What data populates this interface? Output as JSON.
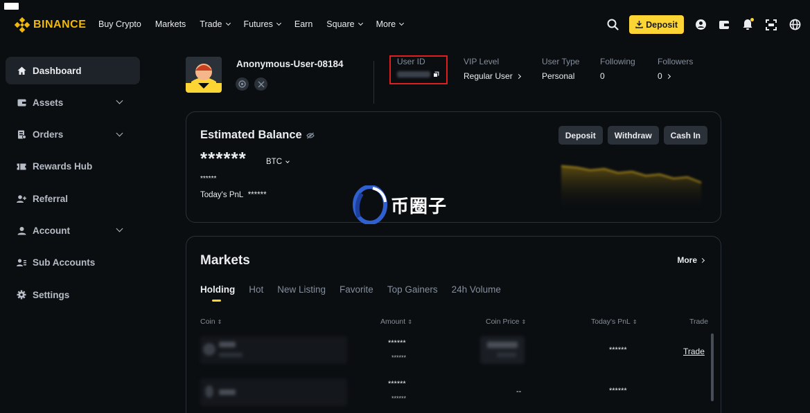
{
  "brand": {
    "name": "BINANCE",
    "color": "#f0b90b"
  },
  "header": {
    "nav": [
      {
        "label": "Buy Crypto",
        "dropdown": false
      },
      {
        "label": "Markets",
        "dropdown": false
      },
      {
        "label": "Trade",
        "dropdown": true
      },
      {
        "label": "Futures",
        "dropdown": true
      },
      {
        "label": "Earn",
        "dropdown": false
      },
      {
        "label": "Square",
        "dropdown": true
      },
      {
        "label": "More",
        "dropdown": true
      }
    ],
    "deposit_label": "Deposit",
    "icons": [
      "search-icon",
      "download-icon",
      "account-icon",
      "wallet-icon",
      "bell-icon",
      "qr-download-icon",
      "globe-icon"
    ]
  },
  "sidebar": {
    "items": [
      {
        "label": "Dashboard",
        "icon": "home-icon",
        "active": true,
        "expandable": false
      },
      {
        "label": "Assets",
        "icon": "wallet-icon",
        "active": false,
        "expandable": true
      },
      {
        "label": "Orders",
        "icon": "orders-icon",
        "active": false,
        "expandable": true
      },
      {
        "label": "Rewards Hub",
        "icon": "ticket-icon",
        "active": false,
        "expandable": false
      },
      {
        "label": "Referral",
        "icon": "add-user-icon",
        "active": false,
        "expandable": false
      },
      {
        "label": "Account",
        "icon": "user-icon",
        "active": false,
        "expandable": true
      },
      {
        "label": "Sub Accounts",
        "icon": "users-icon",
        "active": false,
        "expandable": false
      },
      {
        "label": "Settings",
        "icon": "gear-icon",
        "active": false,
        "expandable": false
      }
    ]
  },
  "profile": {
    "username": "Anonymous-User-08184",
    "user_id_label": "User ID",
    "vip_label": "VIP Level",
    "vip_value": "Regular User",
    "user_type_label": "User Type",
    "user_type_value": "Personal",
    "following_label": "Following",
    "following_value": "0",
    "followers_label": "Followers",
    "followers_value": "0"
  },
  "balance": {
    "title": "Estimated Balance",
    "value": "******",
    "unit": "BTC",
    "sub_value": "******",
    "pnl_label": "Today's PnL",
    "pnl_value": "******",
    "buttons": {
      "deposit": "Deposit",
      "withdraw": "Withdraw",
      "cash_in": "Cash In"
    }
  },
  "markets": {
    "title": "Markets",
    "more_label": "More",
    "tabs": [
      "Holding",
      "Hot",
      "New Listing",
      "Favorite",
      "Top Gainers",
      "24h Volume"
    ],
    "active_tab": "Holding",
    "columns": {
      "coin": "Coin",
      "amount": "Amount",
      "price": "Coin Price",
      "pnl": "Today's PnL",
      "trade": "Trade"
    },
    "rows": [
      {
        "amount": "******",
        "amount_sub": "******",
        "pnl": "******",
        "trade": "Trade",
        "price_text": ""
      },
      {
        "amount": "******",
        "amount_sub": "******",
        "pnl": "******",
        "trade": "",
        "price_text": "--"
      }
    ]
  },
  "watermark": {
    "text": "币圈子"
  },
  "colors": {
    "accent": "#fcd535",
    "background": "#0b0e11",
    "card_border": "#2b3139",
    "highlight_box": "#e02020"
  }
}
